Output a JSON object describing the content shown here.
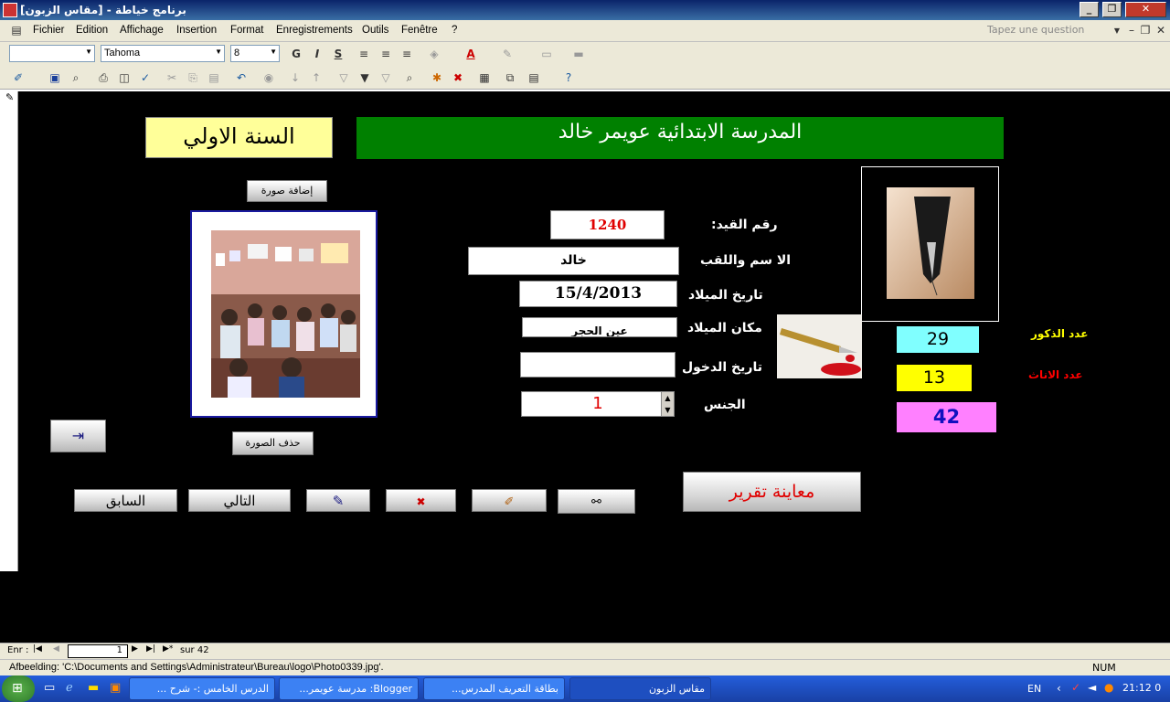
{
  "window": {
    "title": "[برنامج خياطة - [مقاس الزبون"
  },
  "menu": {
    "items": [
      "Fichier",
      "Edition",
      "Affichage",
      "Insertion",
      "Format",
      "Enregistrements",
      "Outils",
      "Fenêtre",
      "?"
    ],
    "ask_placeholder": "Tapez une question"
  },
  "toolbar": {
    "font": "Tahoma",
    "size": "8",
    "bold": "G",
    "italic": "I",
    "underline": "S"
  },
  "form": {
    "school_name": "المدرسة الابتدائية عويمر خالد",
    "year": "السنة الاولي",
    "add_photo": "إضافة صورة",
    "delete_photo": "حذف الصورة",
    "labels": {
      "id": "رقم القيد:",
      "name": "الا سم واللقب",
      "birth_date": "تاريخ الميلاد",
      "birth_place": "مكان الميلاد",
      "entry_date": "تاريخ الدخول",
      "gender": "الجنس",
      "boys": "عدد الذكور",
      "girls": "عدد الاناث"
    },
    "values": {
      "id": "1240",
      "name": "خالد",
      "birth_date": "15/4/2013",
      "birth_place": "عين الحجر",
      "entry_date": "",
      "gender": "1"
    },
    "counts": {
      "boys": "29",
      "girls": "13",
      "total": "42"
    },
    "buttons": {
      "report": "معاينة تقرير",
      "prev": "السابق",
      "next": "التالي"
    }
  },
  "colors": {
    "school_banner": "#008000",
    "year_box": "#ffff99",
    "boys": "#80ffff",
    "girls": "#ffff00",
    "total": "#ff80ff",
    "boys_label": "#ffff00",
    "girls_label": "#ff0000"
  },
  "nav": {
    "label": "Enr :",
    "current": "1",
    "total_label": "sur 42"
  },
  "status": {
    "path": "Afbeelding: 'C:\\Documents and Settings\\Administrateur\\Bureau\\logo\\Photo0339.jpg'.",
    "num": "NUM"
  },
  "taskbar": {
    "tasks": [
      "الدرس الخامس :- شرح ...",
      "Blogger: مدرسة عويمر...",
      "بطاقة التعريف المدرس...",
      "مقاس الزبون"
    ],
    "lang": "EN",
    "clock": "21:12 0"
  }
}
